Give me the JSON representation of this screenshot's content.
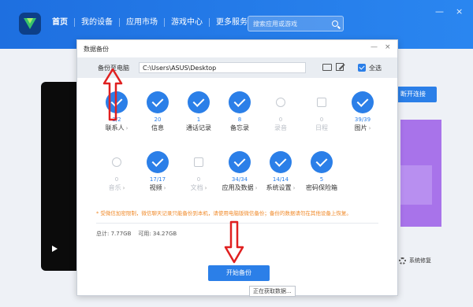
{
  "topbar": {
    "nav": [
      "首页",
      "我的设备",
      "应用市场",
      "游戏中心",
      "更多服务"
    ],
    "search_placeholder": "搜索应用或游戏",
    "window_controls": [
      "—",
      "×"
    ]
  },
  "background": {
    "connect_button": "断开连接",
    "repair_label": "系统修复"
  },
  "dialog": {
    "title": "数据备份",
    "controls": [
      "—",
      "×"
    ],
    "path_label": "备份至电脑",
    "path_value": "C:\\Users\\ASUS\\Desktop",
    "select_all_label": "全选",
    "categories": [
      {
        "count": "2/2",
        "label": "联系人",
        "selected": true,
        "chevron": true
      },
      {
        "count": "20",
        "label": "信息",
        "selected": true,
        "chevron": false
      },
      {
        "count": "1",
        "label": "通话记录",
        "selected": true,
        "chevron": false
      },
      {
        "count": "8",
        "label": "备忘录",
        "selected": true,
        "chevron": false
      },
      {
        "count": "0",
        "label": "录音",
        "selected": false,
        "chevron": false
      },
      {
        "count": "0",
        "label": "日程",
        "selected": false,
        "chevron": false
      },
      {
        "count": "39/39",
        "label": "图片",
        "selected": true,
        "chevron": true
      },
      {
        "count": "0",
        "label": "音乐",
        "selected": false,
        "chevron": true
      },
      {
        "count": "17/17",
        "label": "视频",
        "selected": true,
        "chevron": true
      },
      {
        "count": "0",
        "label": "文档",
        "selected": false,
        "chevron": true
      },
      {
        "count": "34/34",
        "label": "应用及数据",
        "selected": true,
        "chevron": true
      },
      {
        "count": "14/14",
        "label": "系统设置",
        "selected": true,
        "chevron": true
      },
      {
        "count": "5",
        "label": "密码保险箱",
        "selected": true,
        "chevron": false
      }
    ],
    "note": "* 受微信加密限制，微信聊天记录只能备份到本机，请使用电脑版微信备份；备份的数据请勿在其他设备上恢复。",
    "stats": {
      "total_label": "总计:",
      "total": "7.77GB",
      "avail_label": "可用:",
      "avail": "34.27GB"
    },
    "start_button": "开始备份",
    "tooltip": "正在获取数据..."
  },
  "colors": {
    "accent": "#2b7fe8",
    "topbar": "#1e6fe0",
    "annotation": "#e02020",
    "note": "#f08a2a"
  }
}
